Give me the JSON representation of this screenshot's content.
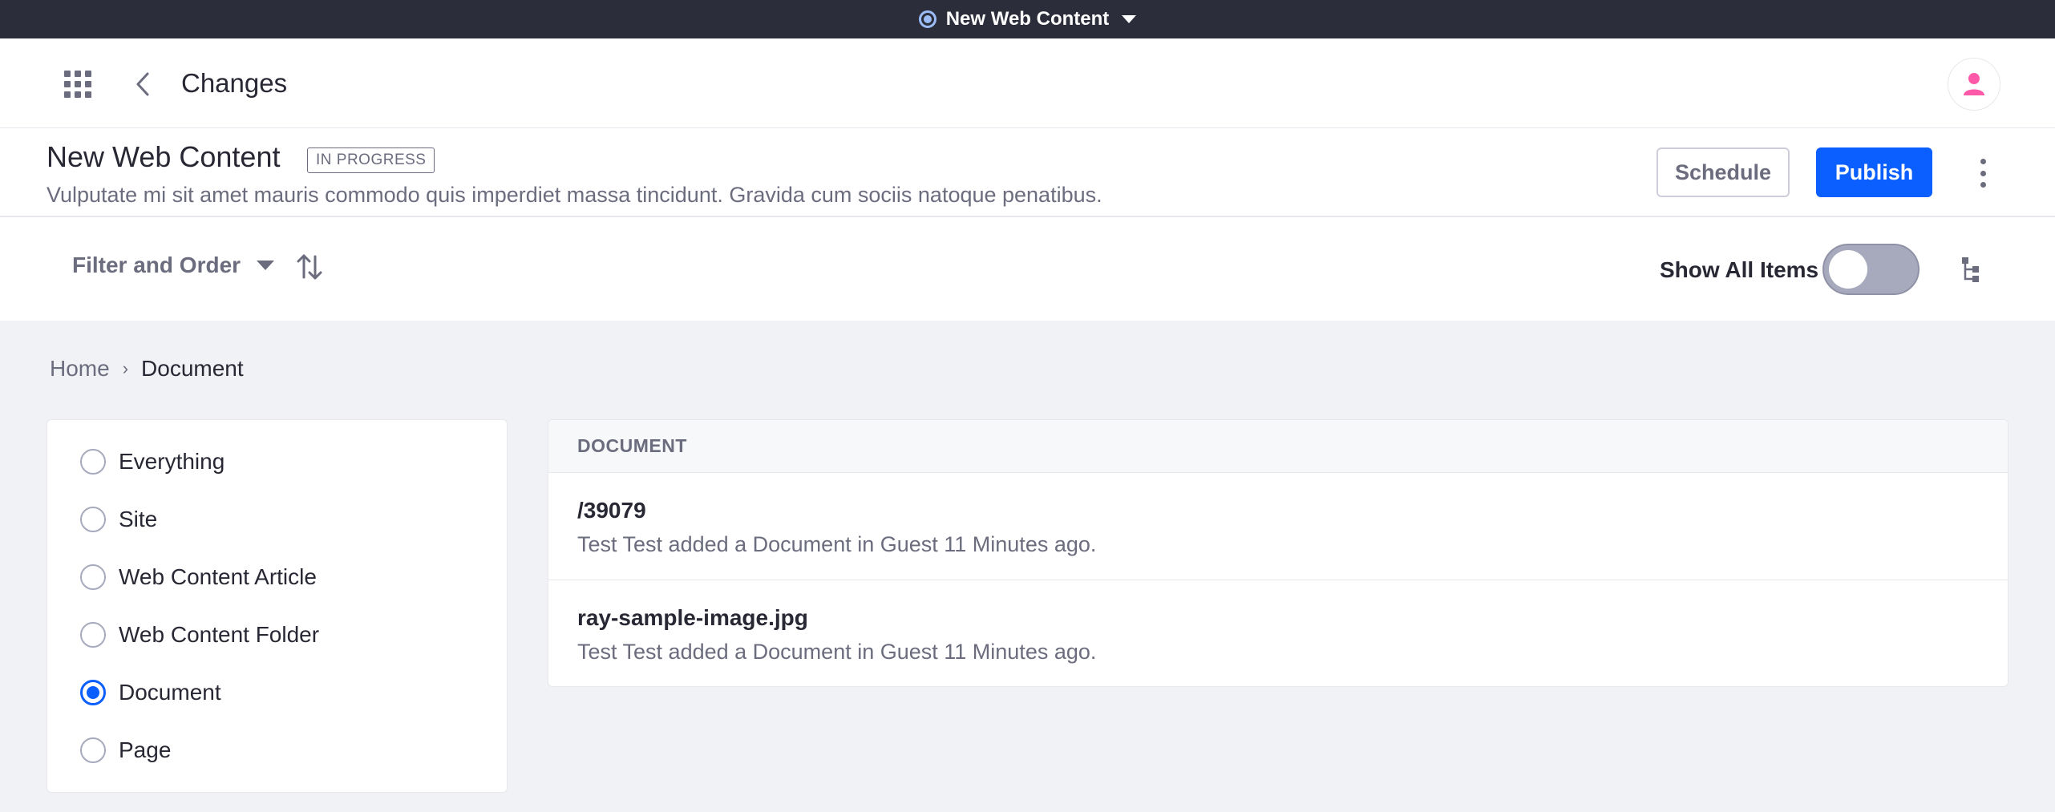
{
  "topbar": {
    "publication_name": "New Web Content",
    "radio_icon": "radio-selected-icon",
    "caret_icon": "caret-down-icon"
  },
  "header": {
    "apps_icon": "apps-grid-icon",
    "back_icon": "chevron-left-icon",
    "title": "Changes",
    "avatar_icon": "user-icon"
  },
  "publication": {
    "name": "New Web Content",
    "status": "IN PROGRESS",
    "description": "Vulputate mi sit amet mauris commodo quis imperdiet massa tincidunt. Gravida cum sociis natoque penatibus.",
    "schedule_label": "Schedule",
    "publish_label": "Publish",
    "more_icon": "ellipsis-vertical-icon"
  },
  "toolbar": {
    "filter_label": "Filter and Order",
    "sort_icon": "order-arrows-icon",
    "show_all_label": "Show All Items",
    "show_all_enabled": false,
    "tree_icon": "hierarchy-icon"
  },
  "breadcrumb": {
    "home": "Home",
    "separator": "›",
    "current": "Document"
  },
  "filters": [
    {
      "label": "Everything",
      "checked": false
    },
    {
      "label": "Site",
      "checked": false
    },
    {
      "label": "Web Content Article",
      "checked": false
    },
    {
      "label": "Web Content Folder",
      "checked": false
    },
    {
      "label": "Document",
      "checked": true
    },
    {
      "label": "Page",
      "checked": false
    }
  ],
  "results": {
    "header": "DOCUMENT",
    "rows": [
      {
        "title": "/39079",
        "subtitle": "Test Test added a Document in Guest 11 Minutes ago."
      },
      {
        "title": "ray-sample-image.jpg",
        "subtitle": "Test Test added a Document in Guest 11 Minutes ago."
      }
    ]
  },
  "colors": {
    "primary": "#0b5fff",
    "topbar_bg": "#2b2d3a",
    "page_bg": "#f1f2f5",
    "avatar_accent": "#ff5aa9"
  }
}
